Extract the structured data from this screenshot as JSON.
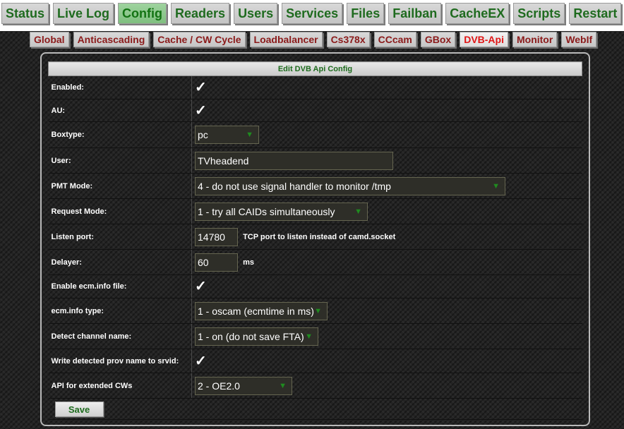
{
  "nav": {
    "main_tabs": [
      {
        "label": "Status"
      },
      {
        "label": "Live Log"
      },
      {
        "label": "Config"
      },
      {
        "label": "Readers"
      },
      {
        "label": "Users"
      },
      {
        "label": "Services"
      },
      {
        "label": "Files"
      },
      {
        "label": "Failban"
      },
      {
        "label": "CacheEX"
      },
      {
        "label": "Scripts"
      },
      {
        "label": "Restart"
      }
    ],
    "active_main": "Config",
    "sub_tabs": [
      {
        "label": "Global"
      },
      {
        "label": "Anticascading"
      },
      {
        "label": "Cache / CW Cycle"
      },
      {
        "label": "Loadbalancer"
      },
      {
        "label": "Cs378x"
      },
      {
        "label": "CCcam"
      },
      {
        "label": "GBox"
      },
      {
        "label": "DVB-Api"
      },
      {
        "label": "Monitor"
      },
      {
        "label": "WebIf"
      }
    ],
    "active_sub": "DVB-Api"
  },
  "form": {
    "title": "Edit DVB Api Config",
    "enabled": {
      "label": "Enabled:",
      "checked": true
    },
    "au": {
      "label": "AU:",
      "checked": true
    },
    "boxtype": {
      "label": "Boxtype:",
      "value": "pc"
    },
    "user": {
      "label": "User:",
      "value": "TVheadend"
    },
    "pmt_mode": {
      "label": "PMT Mode:",
      "value": "4 - do not use signal handler to monitor /tmp"
    },
    "request_mode": {
      "label": "Request Mode:",
      "value": "1 - try all CAIDs simultaneously"
    },
    "listen_port": {
      "label": "Listen port:",
      "value": "14780",
      "hint": "TCP port to listen instead of camd.socket"
    },
    "delayer": {
      "label": "Delayer:",
      "value": "60",
      "unit": "ms"
    },
    "ecm_info_file": {
      "label": "Enable ecm.info file:",
      "checked": true
    },
    "ecm_info_type": {
      "label": "ecm.info type:",
      "value": "1 - oscam (ecmtime in ms)"
    },
    "detect_channel": {
      "label": "Detect channel name:",
      "value": "1 - on (do not save FTA)"
    },
    "write_prov": {
      "label": "Write detected prov name to srvid:",
      "checked": true
    },
    "api_extended": {
      "label": "API for extended CWs",
      "value": "2 - OE2.0"
    },
    "save_label": "Save"
  },
  "icons": {
    "check": "checkmark-icon",
    "dropdown": "chevron-down-icon"
  },
  "colors": {
    "tab_text": "#1f6b1f",
    "active_sub_tab": "#e01515",
    "sub_tab_text": "#8b1a1a"
  }
}
